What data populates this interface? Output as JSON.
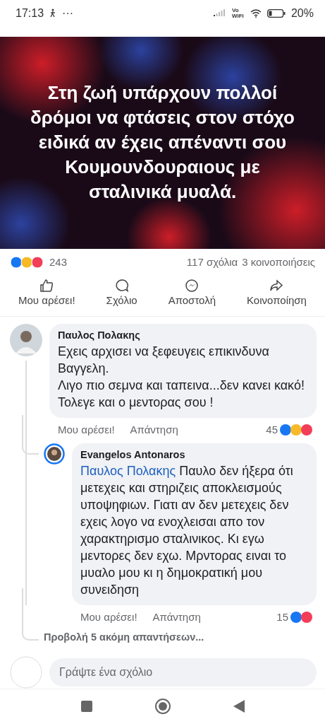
{
  "status_bar": {
    "time": "17:13",
    "more": "···",
    "network": "Vo WiFi",
    "battery": "20%"
  },
  "post": {
    "image_text": "Στη ζωή υπάρχουν πολλοί δρόμοι να φτάσεις στον στόχο ειδικά αν έχεις απέναντι σου Κουμουνδουραιους με σταλινικά μυαλά.",
    "reaction_count": "243",
    "comments": "117 σχόλια",
    "shares": "3 κοινοποιήσεις",
    "actions": [
      {
        "kind": "like",
        "label": "Μου αρέσει!"
      },
      {
        "kind": "comment",
        "label": "Σχόλιο"
      },
      {
        "kind": "send",
        "label": "Αποστολή"
      },
      {
        "kind": "share",
        "label": "Κοινοποίηση"
      }
    ]
  },
  "comment": {
    "author": "Παυλος Πολακης",
    "lines": [
      "Εχεις αρχισει να ξεφευγεις επικινδυνα Βαγγελη.",
      "Λιγο πιο σεμνα και ταπεινα...δεν κανει κακό!",
      "Τολεγε και ο μεντορας σου !"
    ],
    "like": "Μου αρέσει!",
    "reply": "Απάντηση",
    "count": "45",
    "reactions": [
      {
        "color": "#1877f2"
      },
      {
        "color": "#f7b928"
      },
      {
        "color": "#f33e58"
      }
    ],
    "replies": [
      {
        "author": "Evangelos Antonaros",
        "mention": "Παυλος Πολακης",
        "text": "Παυλο δεν ήξερα ότι μετεχεις και στηριζεις αποκλεισμούς υποψηφιων. Γιατι αν δεν μετεχεις δεν εχεις λογο να ενοχλεισαι απο τον χαρακτηρισμο σταλινικος. Κι εγω μεντορες δεν εχω. Μρντορας ειναι το μυαλο μου κι η δημοκρατική μου συνειδηση",
        "like": "Μου αρέσει!",
        "reply": "Απάντηση",
        "count": "15",
        "reactions": [
          {
            "color": "#1877f2"
          },
          {
            "color": "#f33e58"
          }
        ]
      }
    ],
    "more_replies": "Προβολή 5 ακόμη απαντήσεων..."
  },
  "composer": {
    "placeholder": "Γράψτε ένα σχόλιο"
  }
}
